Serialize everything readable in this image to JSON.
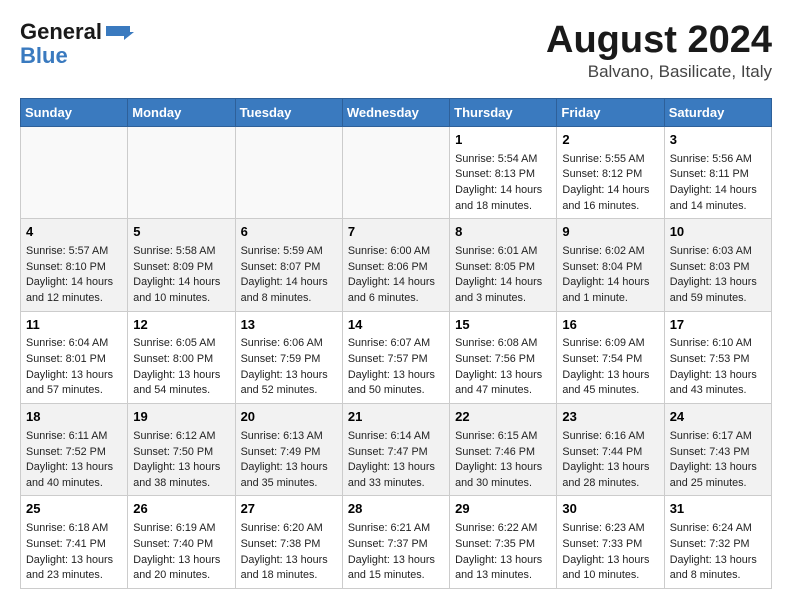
{
  "header": {
    "logo_line1": "General",
    "logo_line2": "Blue",
    "title": "August 2024",
    "subtitle": "Balvano, Basilicate, Italy"
  },
  "days_of_week": [
    "Sunday",
    "Monday",
    "Tuesday",
    "Wednesday",
    "Thursday",
    "Friday",
    "Saturday"
  ],
  "weeks": [
    [
      {
        "day": "",
        "info": ""
      },
      {
        "day": "",
        "info": ""
      },
      {
        "day": "",
        "info": ""
      },
      {
        "day": "",
        "info": ""
      },
      {
        "day": "1",
        "info": "Sunrise: 5:54 AM\nSunset: 8:13 PM\nDaylight: 14 hours\nand 18 minutes."
      },
      {
        "day": "2",
        "info": "Sunrise: 5:55 AM\nSunset: 8:12 PM\nDaylight: 14 hours\nand 16 minutes."
      },
      {
        "day": "3",
        "info": "Sunrise: 5:56 AM\nSunset: 8:11 PM\nDaylight: 14 hours\nand 14 minutes."
      }
    ],
    [
      {
        "day": "4",
        "info": "Sunrise: 5:57 AM\nSunset: 8:10 PM\nDaylight: 14 hours\nand 12 minutes."
      },
      {
        "day": "5",
        "info": "Sunrise: 5:58 AM\nSunset: 8:09 PM\nDaylight: 14 hours\nand 10 minutes."
      },
      {
        "day": "6",
        "info": "Sunrise: 5:59 AM\nSunset: 8:07 PM\nDaylight: 14 hours\nand 8 minutes."
      },
      {
        "day": "7",
        "info": "Sunrise: 6:00 AM\nSunset: 8:06 PM\nDaylight: 14 hours\nand 6 minutes."
      },
      {
        "day": "8",
        "info": "Sunrise: 6:01 AM\nSunset: 8:05 PM\nDaylight: 14 hours\nand 3 minutes."
      },
      {
        "day": "9",
        "info": "Sunrise: 6:02 AM\nSunset: 8:04 PM\nDaylight: 14 hours\nand 1 minute."
      },
      {
        "day": "10",
        "info": "Sunrise: 6:03 AM\nSunset: 8:03 PM\nDaylight: 13 hours\nand 59 minutes."
      }
    ],
    [
      {
        "day": "11",
        "info": "Sunrise: 6:04 AM\nSunset: 8:01 PM\nDaylight: 13 hours\nand 57 minutes."
      },
      {
        "day": "12",
        "info": "Sunrise: 6:05 AM\nSunset: 8:00 PM\nDaylight: 13 hours\nand 54 minutes."
      },
      {
        "day": "13",
        "info": "Sunrise: 6:06 AM\nSunset: 7:59 PM\nDaylight: 13 hours\nand 52 minutes."
      },
      {
        "day": "14",
        "info": "Sunrise: 6:07 AM\nSunset: 7:57 PM\nDaylight: 13 hours\nand 50 minutes."
      },
      {
        "day": "15",
        "info": "Sunrise: 6:08 AM\nSunset: 7:56 PM\nDaylight: 13 hours\nand 47 minutes."
      },
      {
        "day": "16",
        "info": "Sunrise: 6:09 AM\nSunset: 7:54 PM\nDaylight: 13 hours\nand 45 minutes."
      },
      {
        "day": "17",
        "info": "Sunrise: 6:10 AM\nSunset: 7:53 PM\nDaylight: 13 hours\nand 43 minutes."
      }
    ],
    [
      {
        "day": "18",
        "info": "Sunrise: 6:11 AM\nSunset: 7:52 PM\nDaylight: 13 hours\nand 40 minutes."
      },
      {
        "day": "19",
        "info": "Sunrise: 6:12 AM\nSunset: 7:50 PM\nDaylight: 13 hours\nand 38 minutes."
      },
      {
        "day": "20",
        "info": "Sunrise: 6:13 AM\nSunset: 7:49 PM\nDaylight: 13 hours\nand 35 minutes."
      },
      {
        "day": "21",
        "info": "Sunrise: 6:14 AM\nSunset: 7:47 PM\nDaylight: 13 hours\nand 33 minutes."
      },
      {
        "day": "22",
        "info": "Sunrise: 6:15 AM\nSunset: 7:46 PM\nDaylight: 13 hours\nand 30 minutes."
      },
      {
        "day": "23",
        "info": "Sunrise: 6:16 AM\nSunset: 7:44 PM\nDaylight: 13 hours\nand 28 minutes."
      },
      {
        "day": "24",
        "info": "Sunrise: 6:17 AM\nSunset: 7:43 PM\nDaylight: 13 hours\nand 25 minutes."
      }
    ],
    [
      {
        "day": "25",
        "info": "Sunrise: 6:18 AM\nSunset: 7:41 PM\nDaylight: 13 hours\nand 23 minutes."
      },
      {
        "day": "26",
        "info": "Sunrise: 6:19 AM\nSunset: 7:40 PM\nDaylight: 13 hours\nand 20 minutes."
      },
      {
        "day": "27",
        "info": "Sunrise: 6:20 AM\nSunset: 7:38 PM\nDaylight: 13 hours\nand 18 minutes."
      },
      {
        "day": "28",
        "info": "Sunrise: 6:21 AM\nSunset: 7:37 PM\nDaylight: 13 hours\nand 15 minutes."
      },
      {
        "day": "29",
        "info": "Sunrise: 6:22 AM\nSunset: 7:35 PM\nDaylight: 13 hours\nand 13 minutes."
      },
      {
        "day": "30",
        "info": "Sunrise: 6:23 AM\nSunset: 7:33 PM\nDaylight: 13 hours\nand 10 minutes."
      },
      {
        "day": "31",
        "info": "Sunrise: 6:24 AM\nSunset: 7:32 PM\nDaylight: 13 hours\nand 8 minutes."
      }
    ]
  ]
}
